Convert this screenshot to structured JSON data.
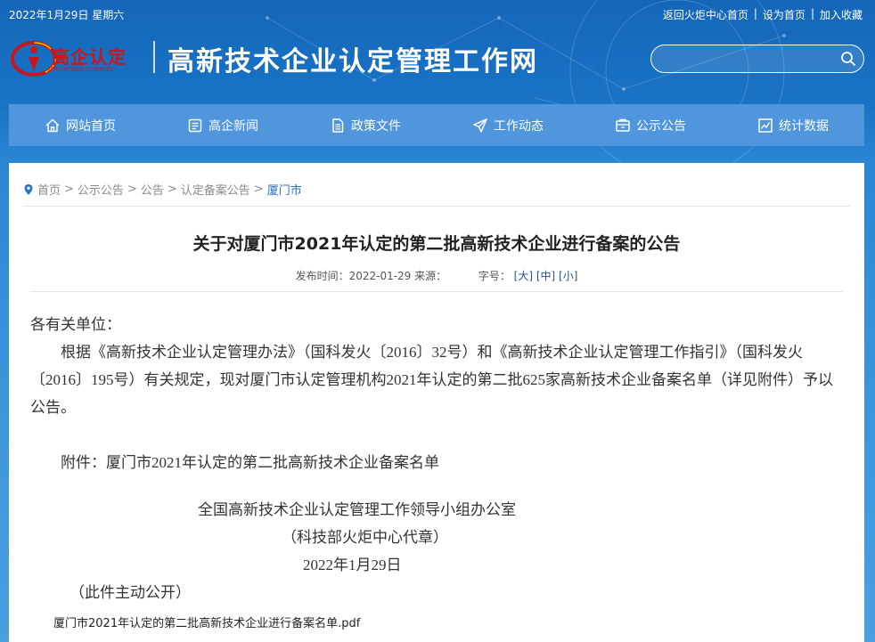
{
  "topbar": {
    "date": "2022年1月29日 星期六",
    "links": [
      "返回火炬中心首页",
      "设为首页",
      "加入收藏"
    ],
    "separator": "|"
  },
  "header": {
    "logo_text": "高企认定",
    "logo_sub": "INNOVATION COMPANY",
    "site_title": "高新技术企业认定管理工作网",
    "search_placeholder": ""
  },
  "nav": {
    "items": [
      {
        "label": "网站首页",
        "icon": "home-icon"
      },
      {
        "label": "高企新闻",
        "icon": "news-icon"
      },
      {
        "label": "政策文件",
        "icon": "document-icon"
      },
      {
        "label": "工作动态",
        "icon": "paper-plane-icon"
      },
      {
        "label": "公示公告",
        "icon": "announcement-icon"
      },
      {
        "label": "统计数据",
        "icon": "chart-icon"
      }
    ]
  },
  "breadcrumb": {
    "items": [
      "首页",
      "公示公告",
      "公告",
      "认定备案公告",
      "厦门市"
    ],
    "separator": ">"
  },
  "article": {
    "title": "关于对厦门市2021年认定的第二批高新技术企业进行备案的公告",
    "meta_published": "发布时间：2022-01-29 来源：",
    "meta_fontsize": "字号：",
    "font_large": "[大]",
    "font_medium": "[中]",
    "font_small": "[小]",
    "salutation": "各有关单位：",
    "paragraph": "根据《高新技术企业认定管理办法》（国科发火〔2016〕32号）和《高新技术企业认定管理工作指引》（国科发火〔2016〕195号）有关规定，现对厦门市认定管理机构2021年认定的第二批625家高新技术企业备案名单（详见附件）予以公告。",
    "attachment": "附件：厦门市2021年认定的第二批高新技术企业备案名单",
    "sign_org": "全国高新技术企业认定管理工作领导小组办公室",
    "sign_sub": "（科技部火炬中心代章）",
    "sign_date": "2022年1月29日",
    "public_note": "（此件主动公开）",
    "pdf_link": "厦门市2021年认定的第二批高新技术企业进行备案名单.pdf"
  },
  "colors": {
    "nav_bg": "#4f96dc",
    "link_blue": "#2a72c2",
    "logo_red": "#c8161d"
  }
}
